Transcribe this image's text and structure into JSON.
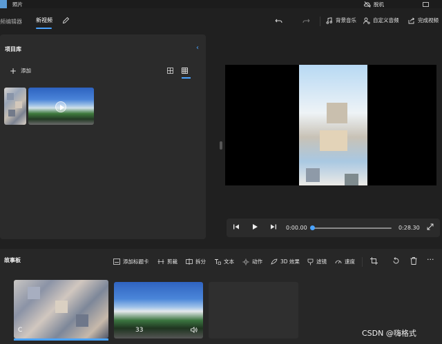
{
  "titlebar": {
    "app_name": "照片",
    "offline_label": "脱机"
  },
  "header": {
    "breadcrumb_prev": "频编辑器",
    "breadcrumb_current": "新视频",
    "buttons": [
      {
        "label": "背景音乐",
        "icon": "music-note-icon"
      },
      {
        "label": "自定义音频",
        "icon": "audio-person-icon"
      },
      {
        "label": "完成视频",
        "icon": "share-icon"
      }
    ]
  },
  "library": {
    "title": "项目库",
    "add_label": "添加",
    "collapse_icon": "chevron-left-icon",
    "view_modes": [
      "grid-large-icon",
      "grid-small-icon"
    ]
  },
  "player": {
    "current_time": "0:00.00",
    "total_time": "0:28.30",
    "progress": 0.0
  },
  "storyboard": {
    "title": "故事板",
    "tools": [
      {
        "label": "添加标题卡",
        "icon": "title-card-icon"
      },
      {
        "label": "剪裁",
        "icon": "trim-icon"
      },
      {
        "label": "拆分",
        "icon": "split-icon"
      },
      {
        "label": "文本",
        "icon": "text-icon"
      },
      {
        "label": "动作",
        "icon": "motion-icon"
      },
      {
        "label": "3D 效果",
        "icon": "3d-effects-icon"
      },
      {
        "label": "滤镜",
        "icon": "filter-icon"
      },
      {
        "label": "速度",
        "icon": "speed-icon"
      }
    ],
    "clips": [
      {
        "duration": "C"
      },
      {
        "duration": "33"
      }
    ]
  },
  "watermark": "CSDN @嗨格式",
  "colors": {
    "accent": "#4aa3ff",
    "background": "#202020",
    "panel": "#2b2b2b"
  }
}
